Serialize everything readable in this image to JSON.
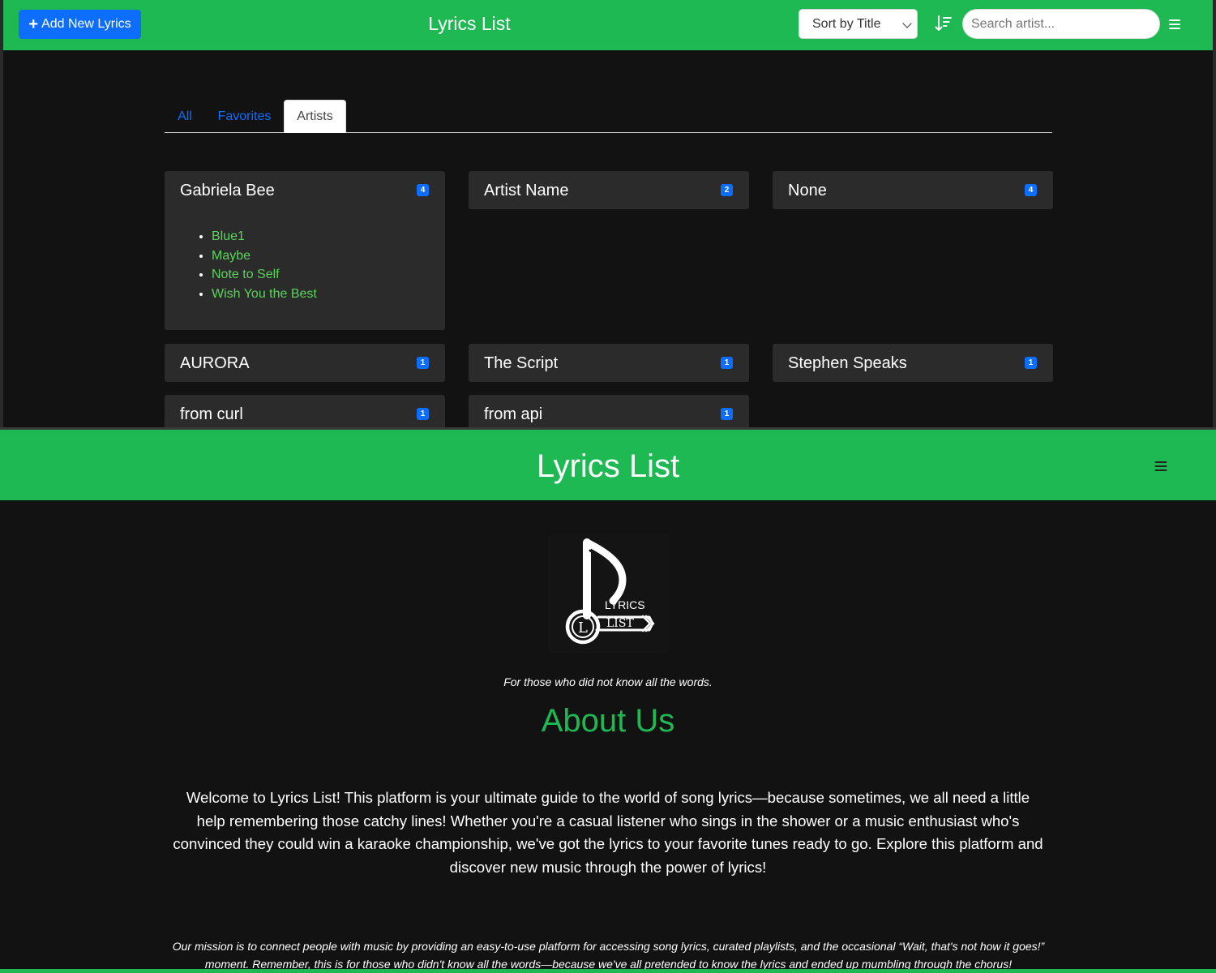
{
  "top": {
    "add_button_label": "Add New Lyrics",
    "title": "Lyrics List",
    "sort_select_value": "Sort by Title",
    "search_placeholder": "Search artist...",
    "tabs": [
      {
        "label": "All",
        "active": false
      },
      {
        "label": "Favorites",
        "active": false
      },
      {
        "label": "Artists",
        "active": true
      }
    ],
    "artists": [
      {
        "name": "Gabriela Bee",
        "count": "4",
        "songs": [
          "Blue1",
          "Maybe",
          "Note to Self",
          "Wish You the Best"
        ]
      },
      {
        "name": "Artist Name",
        "count": "2"
      },
      {
        "name": "None",
        "count": "4"
      },
      {
        "name": "AURORA",
        "count": "1"
      },
      {
        "name": "The Script",
        "count": "1"
      },
      {
        "name": "Stephen Speaks",
        "count": "1"
      },
      {
        "name": "from curl",
        "count": "1"
      },
      {
        "name": "from api",
        "count": "1"
      }
    ]
  },
  "bottom": {
    "title": "Lyrics List",
    "logo": {
      "line1": "LYRICS",
      "line2": "LIST",
      "initial": "L"
    },
    "tagline": "For those who did not know all the words.",
    "about_title": "About Us",
    "about_body": "Welcome to Lyrics List! This platform is your ultimate guide to the world of song lyrics—because sometimes, we all need a little help remembering those catchy lines! Whether you're a casual listener who sings in the shower or a music enthusiast who's convinced they could win a karaoke championship, we've got the lyrics to your favorite tunes ready to go. Explore this platform and discover new music through the power of lyrics!",
    "mission": "Our mission is to connect people with music by providing an easy-to-use platform for accessing song lyrics, curated playlists, and the occasional “Wait, that's not how it goes!” moment. Remember, this is for those who didn't know all the words—because we've all pretended to know the lyrics and ended up mumbling through the chorus!"
  },
  "colors": {
    "brand_green": "#1fb954",
    "primary_blue": "#0d6efd",
    "background": "#121212",
    "card": "#2b2b2b",
    "song_link": "#5ad45a"
  },
  "icons": [
    "plus-icon",
    "sort-direction-icon",
    "hamburger-menu-icon",
    "music-note-logo"
  ]
}
